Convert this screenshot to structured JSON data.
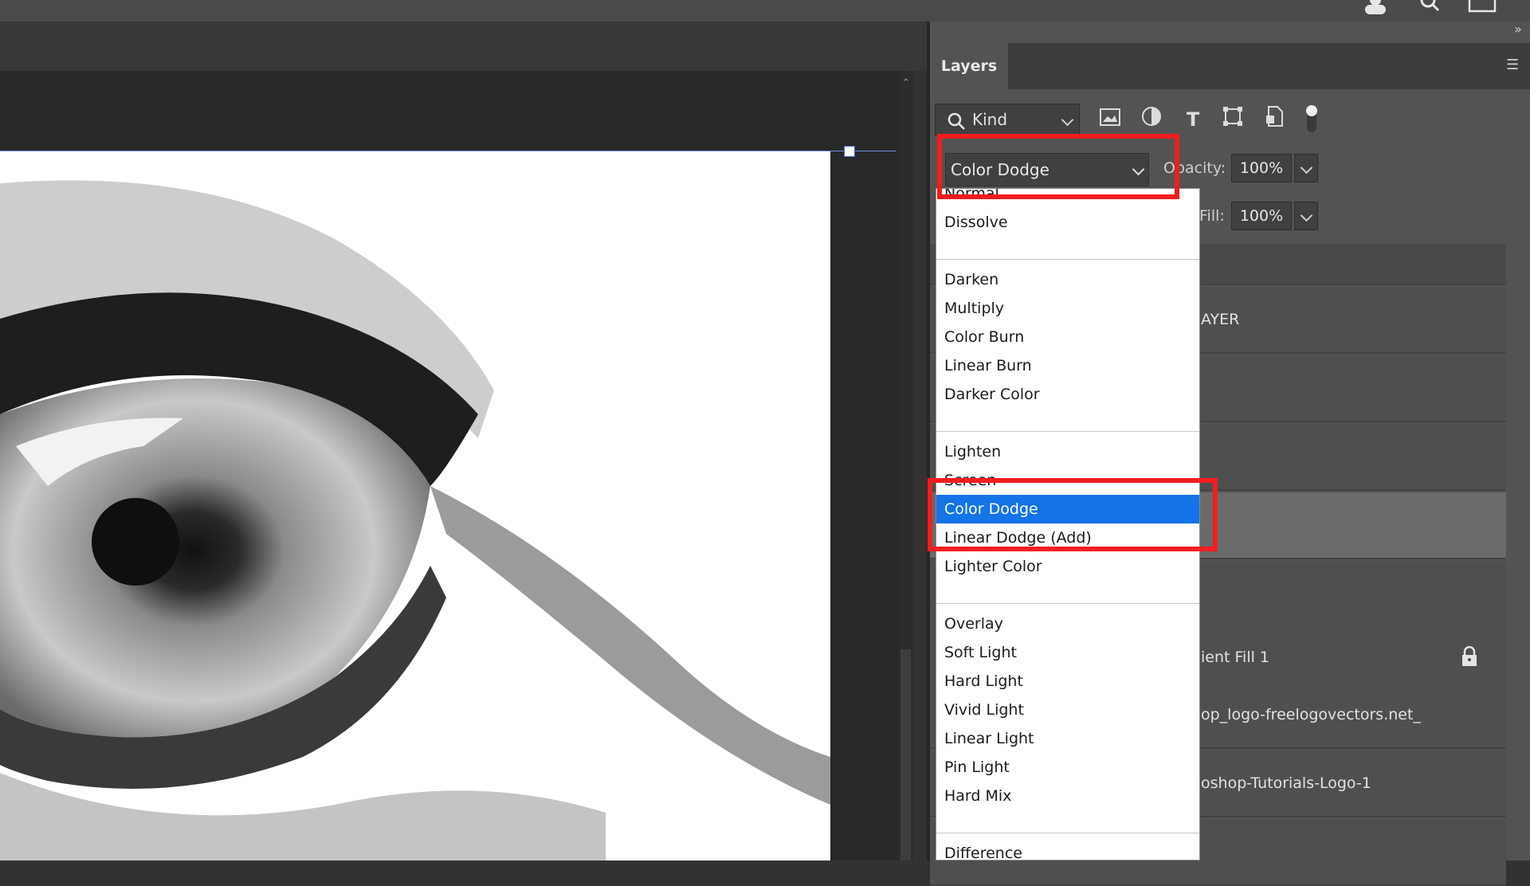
{
  "layers_panel": {
    "tab_label": "Layers",
    "filter": {
      "kind_label": "Kind"
    },
    "blend_mode": {
      "selected": "Color Dodge"
    },
    "opacity": {
      "label": "Opacity:",
      "value": "100%"
    },
    "fill": {
      "label": "Fill:",
      "value": "100%"
    },
    "layers": [
      {
        "name": ""
      },
      {
        "name": "AYER"
      },
      {
        "name": ""
      },
      {
        "name": ""
      },
      {
        "name": ""
      },
      {
        "name": ""
      },
      {
        "name": "ient Fill 1"
      },
      {
        "name": "op_logo-freelogovectors.net_"
      },
      {
        "name": "oshop-Tutorials-Logo-1"
      },
      {
        "name": ""
      }
    ]
  },
  "blend_dropdown": {
    "items": [
      "Normal",
      "Dissolve",
      "Darken",
      "Multiply",
      "Color Burn",
      "Linear Burn",
      "Darker Color",
      "Lighten",
      "Screen",
      "Color Dodge",
      "Linear Dodge (Add)",
      "Lighter Color",
      "Overlay",
      "Soft Light",
      "Hard Light",
      "Vivid Light",
      "Linear Light",
      "Pin Light",
      "Hard Mix",
      "Difference"
    ],
    "selected_item": "Color Dodge"
  },
  "icons": {
    "search": "search-icon",
    "image_filter": "image-filter-icon",
    "adjustment_filter": "adjustment-filter-icon",
    "type_filter": "type-filter-icon",
    "shape_filter": "shape-filter-icon",
    "smart_object_filter": "smart-object-filter-icon",
    "filter_toggle": "filter-toggle-icon",
    "lock": "lock-icon",
    "user": "user-icon",
    "search_top": "search-icon",
    "workspace": "workspace-icon",
    "collapse": "collapse-panels-icon",
    "panel_menu": "panel-menu-icon"
  },
  "colors": {
    "selection_blue": "#1473e6",
    "highlight_red": "#f21d20",
    "panel_bg": "#535353"
  }
}
